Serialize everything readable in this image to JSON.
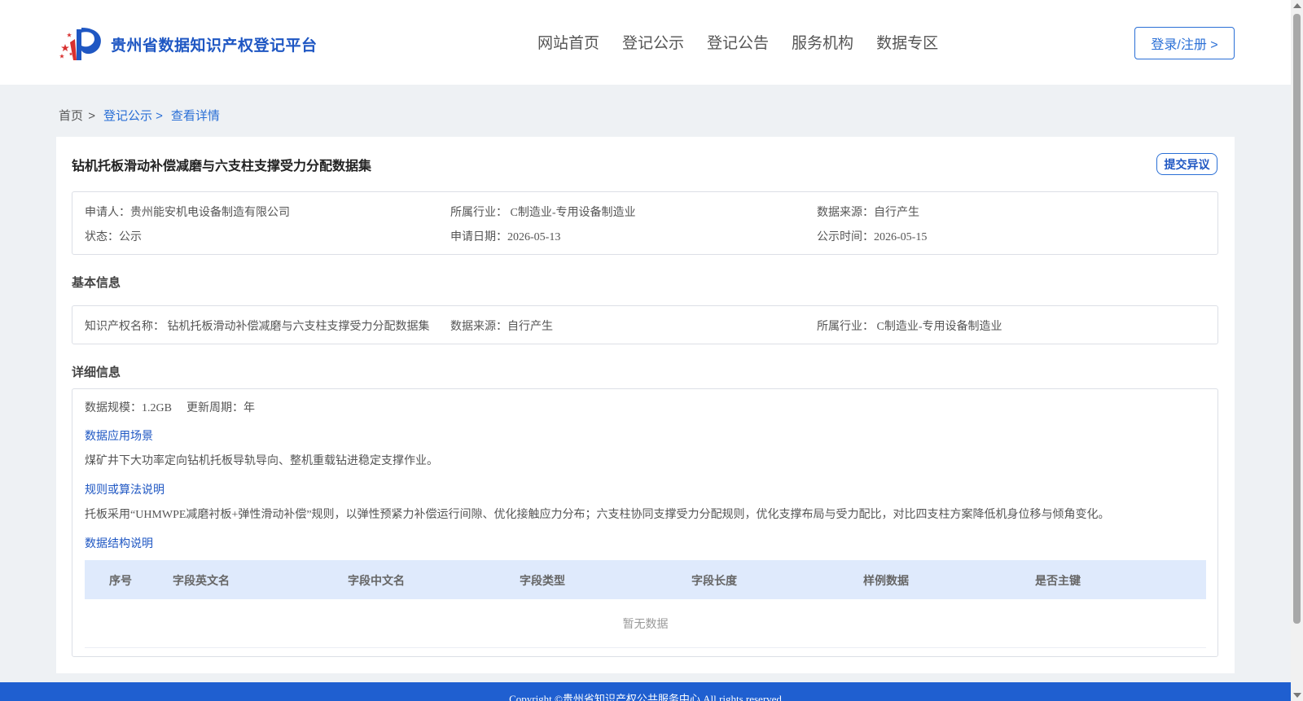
{
  "header": {
    "site_title": "贵州省数据知识产权登记平台",
    "nav": [
      "网站首页",
      "登记公示",
      "登记公告",
      "服务机构",
      "数据专区"
    ],
    "login_label": "登录/注册 >"
  },
  "breadcrumb": {
    "home": "首页",
    "sep": ">",
    "items": [
      "登记公示 >",
      "查看详情"
    ]
  },
  "record": {
    "title": "钻机托板滑动补偿减磨与六支柱支撑受力分配数据集",
    "objection_label": "提交异议",
    "summary": {
      "applicant": "申请人：贵州能安机电设备制造有限公司",
      "industry": "所属行业： C制造业-专用设备制造业",
      "source": "数据来源：自行产生",
      "status": "状态：公示",
      "apply_date": "申请日期：2026-05-13",
      "publish_date": "公示时间：2026-05-15"
    },
    "basic_title": "基本信息",
    "basic": {
      "ip_name": "知识产权名称： 钻机托板滑动补偿减磨与六支柱支撑受力分配数据集",
      "source": "数据来源：自行产生",
      "industry": "所属行业： C制造业-专用设备制造业"
    },
    "detail_title": "详细信息",
    "detail": {
      "scale": "数据规模：1.2GB",
      "cycle": "更新周期：年",
      "scenario_title": "数据应用场景",
      "scenario_text": "煤矿井下大功率定向钻机托板导轨导向、整机重载钻进稳定支撑作业。",
      "rule_title": "规则或算法说明",
      "rule_text": "托板采用“UHMWPE减磨衬板+弹性滑动补偿”规则，以弹性预紧力补偿运行间隙、优化接触应力分布；六支柱协同支撑受力分配规则，优化支撑布局与受力配比，对比四支柱方案降低机身位移与倾角变化。",
      "structure_title": "数据结构说明",
      "columns": [
        "序号",
        "字段英文名",
        "字段中文名",
        "字段类型",
        "字段长度",
        "样例数据",
        "是否主键"
      ],
      "empty_text": "暂无数据"
    }
  },
  "footer": {
    "copyright": "Copyright ©贵州省知识产权公共服务中心 All rights reserved"
  }
}
